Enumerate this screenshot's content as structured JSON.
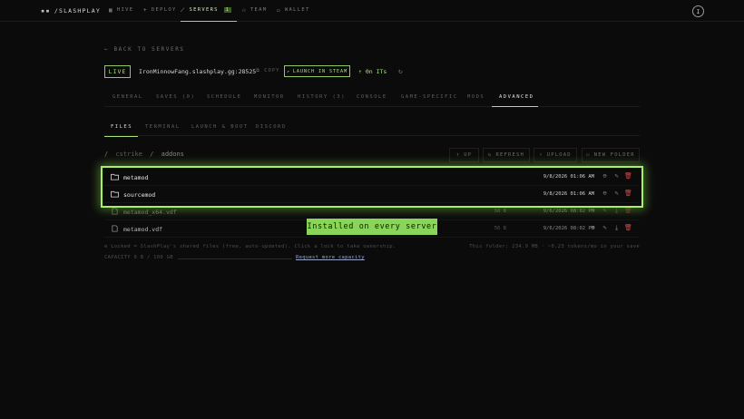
{
  "brand": {
    "logo": "/SLASHPLAY"
  },
  "nav": {
    "items": [
      {
        "label": "HIVE"
      },
      {
        "label": "DEPLOY"
      },
      {
        "label": "SERVERS",
        "badge": "1"
      },
      {
        "label": "TEAM"
      },
      {
        "label": "WALLET"
      }
    ],
    "active": "SERVERS",
    "avatar": "I"
  },
  "back_link": "BACK TO SERVERS",
  "server": {
    "status": "LIVE",
    "address": "IronMinnowFang.slashplay.gg:28525",
    "copy_label": "COPY",
    "steam_label": "LAUNCH IN STEAM",
    "players": "0n ITs"
  },
  "main_tabs": [
    "GENERAL",
    "SAVES (0)",
    "SCHEDULE",
    "MONITOR",
    "HISTORY (3)",
    "CONSOLE",
    "GAME-SPECIFIC",
    "MODS",
    "ADVANCED"
  ],
  "main_tab_active": "ADVANCED",
  "sub_tabs": [
    "FILES",
    "TERMINAL",
    "LAUNCH & BOOT",
    "DISCORD"
  ],
  "sub_tab_active": "FILES",
  "path": {
    "root": "cstrike",
    "current": "addons"
  },
  "toolbar": {
    "up": "UP",
    "refresh": "REFRESH",
    "upload": "UPLOAD",
    "new_folder": "NEW FOLDER"
  },
  "files": [
    {
      "name": "metamod",
      "type": "folder",
      "size": "",
      "modified": "9/8/2026 01:06 AM",
      "locked": true
    },
    {
      "name": "sourcemod",
      "type": "folder",
      "size": "",
      "modified": "9/8/2026 01:06 AM",
      "locked": true
    },
    {
      "name": "metamod_x64.vdf",
      "type": "file",
      "size": "58 B",
      "modified": "9/6/2026 08:02 PM",
      "locked": false
    },
    {
      "name": "metamod.vdf",
      "type": "file",
      "size": "56 B",
      "modified": "9/6/2026 08:02 PM",
      "locked": false
    }
  ],
  "tooltip": "Installed on every server",
  "footer": {
    "locked_note": "Locked = SlashPlay's shared files (free, auto-updated). Click a lock to take ownership.",
    "folder_info": "This folder: 234.9 MB · ~0.23 tokens/mo in your save",
    "capacity": "CAPACITY 0 B / 100 GB",
    "request_link": "Request more capacity"
  },
  "colors": {
    "accent": "#a9e07a",
    "highlight": "#a6f06a",
    "danger": "#d24b4b",
    "background": "#0b0b0b"
  }
}
